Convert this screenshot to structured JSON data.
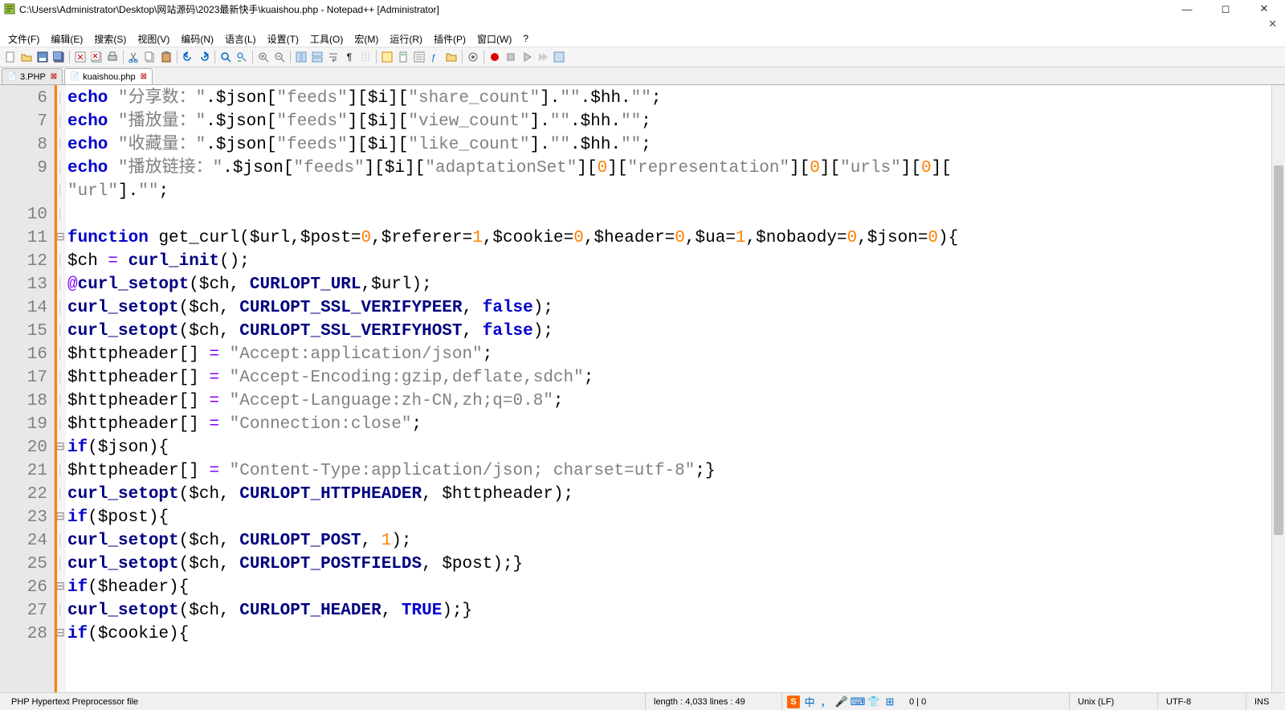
{
  "title": "C:\\Users\\Administrator\\Desktop\\网站源码\\2023最新快手\\kuaishou.php - Notepad++ [Administrator]",
  "menu": {
    "file": "文件(F)",
    "edit": "编辑(E)",
    "search": "搜索(S)",
    "view": "视图(V)",
    "encoding": "编码(N)",
    "language": "语言(L)",
    "settings": "设置(T)",
    "tools": "工具(O)",
    "macro": "宏(M)",
    "run": "运行(R)",
    "plugins": "插件(P)",
    "window": "窗口(W)",
    "help": "?"
  },
  "tabs": [
    {
      "label": "3.PHP",
      "active": false
    },
    {
      "label": "kuaishou.php",
      "active": true
    }
  ],
  "lines": {
    "start": 6,
    "end": 28,
    "gutter": [
      "6",
      "7",
      "8",
      "9",
      "",
      "10",
      "11",
      "12",
      "13",
      "14",
      "15",
      "16",
      "17",
      "18",
      "19",
      "20",
      "21",
      "22",
      "23",
      "24",
      "25",
      "26",
      "27",
      "28"
    ],
    "fold": [
      "",
      "",
      "",
      "",
      "",
      "",
      "⊟",
      "",
      "",
      "",
      "",
      "",
      "",
      "",
      "",
      "⊟",
      "",
      "",
      "⊟",
      "",
      "",
      "⊟",
      "",
      "⊟"
    ]
  },
  "code": {
    "l6": {
      "kw": "echo",
      "s1": "\"分享数：\"",
      "v1": "$json",
      "b1": "[",
      "s2": "\"feeds\"",
      "b2": "][",
      "v2": "$i",
      "b3": "][",
      "s3": "\"share_count\"",
      "b4": "].",
      "s4": "\"\"",
      "d1": ".",
      "v3": "$hh",
      "d2": ".",
      "s5": "\"\"",
      "e": ";"
    },
    "l7": {
      "kw": "echo",
      "s1": "\"播放量：\"",
      "v1": "$json",
      "s2": "\"feeds\"",
      "v2": "$i",
      "s3": "\"view_count\"",
      "s4": "\"\"",
      "v3": "$hh",
      "s5": "\"\""
    },
    "l8": {
      "kw": "echo",
      "s1": "\"收藏量：\"",
      "v1": "$json",
      "s2": "\"feeds\"",
      "v2": "$i",
      "s3": "\"like_count\"",
      "s4": "\"\"",
      "v3": "$hh",
      "s5": "\"\""
    },
    "l9a": {
      "kw": "echo",
      "s1": "\"播放链接：\"",
      "v1": "$json",
      "s2": "\"feeds\"",
      "v2": "$i",
      "s3": "\"adaptationSet\"",
      "n1": "0",
      "s4": "\"representation\"",
      "n2": "0",
      "s5": "\"urls\"",
      "n3": "0"
    },
    "l9b": {
      "s1": "\"url\"",
      "s2": "\"\""
    },
    "l11": {
      "kw": "function",
      "fn": "get_curl",
      "v1": "$url",
      "v2": "$post",
      "n1": "0",
      "v3": "$referer",
      "n2": "1",
      "v4": "$cookie",
      "n3": "0",
      "v5": "$header",
      "n4": "0",
      "v6": "$ua",
      "n5": "1",
      "v7": "$nobaody",
      "n6": "0",
      "v8": "$json",
      "n7": "0"
    },
    "l12": {
      "v1": "$ch",
      "fn": "curl_init"
    },
    "l13": {
      "fn": "curl_setopt",
      "v1": "$ch",
      "c": "CURLOPT_URL",
      "v2": "$url"
    },
    "l14": {
      "fn": "curl_setopt",
      "v1": "$ch",
      "c": "CURLOPT_SSL_VERIFYPEER",
      "kw": "false"
    },
    "l15": {
      "fn": "curl_setopt",
      "v1": "$ch",
      "c": "CURLOPT_SSL_VERIFYHOST",
      "kw": "false"
    },
    "l16": {
      "v": "$httpheader",
      "s": "\"Accept:application/json\""
    },
    "l17": {
      "v": "$httpheader",
      "s": "\"Accept-Encoding:gzip,deflate,sdch\""
    },
    "l18": {
      "v": "$httpheader",
      "s": "\"Accept-Language:zh-CN,zh;q=0.8\""
    },
    "l19": {
      "v": "$httpheader",
      "s": "\"Connection:close\""
    },
    "l20": {
      "kw": "if",
      "v": "$json"
    },
    "l21": {
      "v": "$httpheader",
      "s": "\"Content-Type:application/json; charset=utf-8\""
    },
    "l22": {
      "fn": "curl_setopt",
      "v1": "$ch",
      "c": "CURLOPT_HTTPHEADER",
      "v2": "$httpheader"
    },
    "l23": {
      "kw": "if",
      "v": "$post"
    },
    "l24": {
      "fn": "curl_setopt",
      "v1": "$ch",
      "c": "CURLOPT_POST",
      "n": "1"
    },
    "l25": {
      "fn": "curl_setopt",
      "v1": "$ch",
      "c": "CURLOPT_POSTFIELDS",
      "v2": "$post"
    },
    "l26": {
      "kw": "if",
      "v": "$header"
    },
    "l27": {
      "fn": "curl_setopt",
      "v1": "$ch",
      "c": "CURLOPT_HEADER",
      "kw2": "TRUE"
    },
    "l28": {
      "kw": "if",
      "v": "$cookie"
    }
  },
  "status": {
    "filetype": "PHP Hypertext Preprocessor file",
    "length": "length : 4,033    lines : 49",
    "pos": "0 | 0",
    "eol": "Unix (LF)",
    "enc": "UTF-8",
    "ins": "INS"
  },
  "tray": {
    "sogou": "S",
    "ime": "中"
  }
}
